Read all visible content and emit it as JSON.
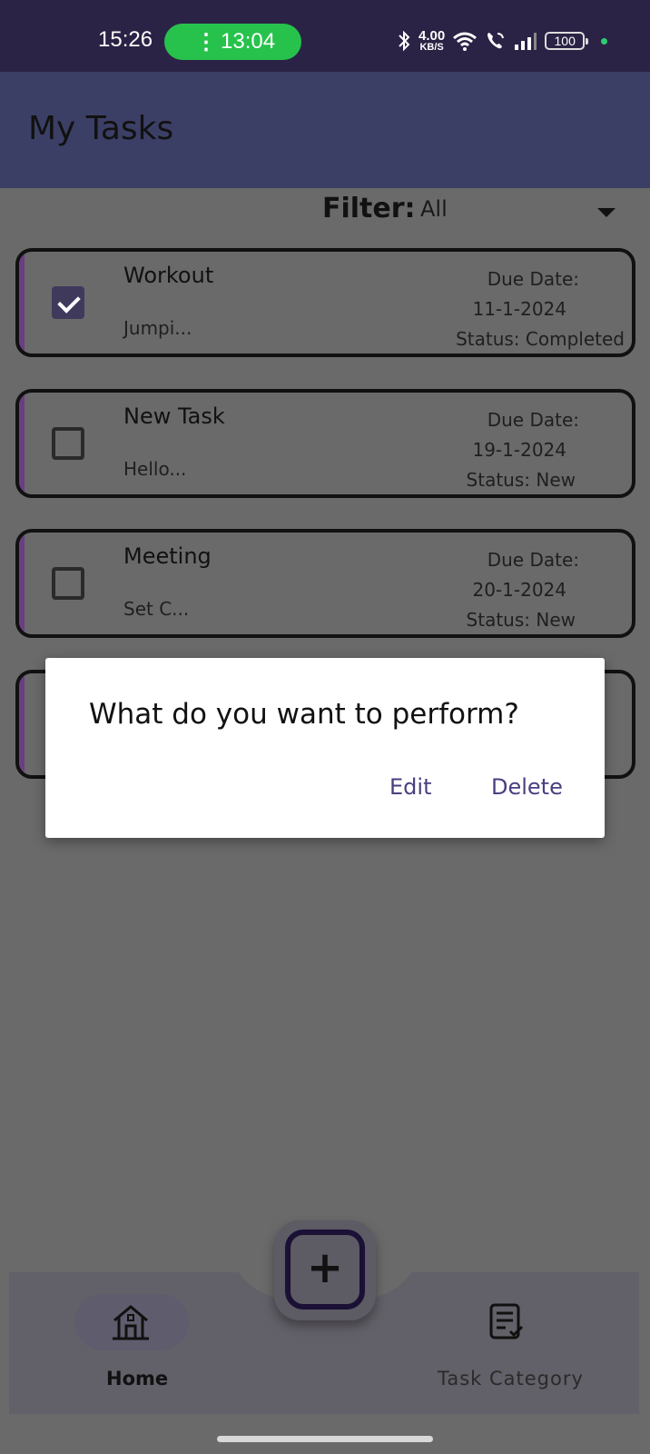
{
  "status_bar": {
    "time": "15:26",
    "timer": "13:04",
    "net_speed": "4.00",
    "net_unit": "KB/S",
    "battery": "100"
  },
  "appbar": {
    "title": "My Tasks"
  },
  "filter": {
    "label": "Filter:",
    "value": "All"
  },
  "tasks": [
    {
      "title": "Workout",
      "desc": "Jumpi...",
      "due_label": "Due Date:",
      "due": "11-1-2024",
      "status": "Status: Completed",
      "checked": true
    },
    {
      "title": "New Task",
      "desc": "Hello...",
      "due_label": "Due Date:",
      "due": "19-1-2024",
      "status": "Status: New",
      "checked": false
    },
    {
      "title": "Meeting",
      "desc": "Set C...",
      "due_label": "Due Date:",
      "due": "20-1-2024",
      "status": "Status: New",
      "checked": false
    }
  ],
  "dialog": {
    "question": "What do you want to perform?",
    "edit": "Edit",
    "delete": "Delete"
  },
  "bottom_nav": {
    "home": "Home",
    "category": "Task Category"
  },
  "icons": {
    "add": "plus-square-icon",
    "home": "home-icon",
    "category": "clipboard-list-icon"
  },
  "colors": {
    "appbar": "#3c3f65",
    "accent": "#6b3d82",
    "dialog_button": "#4a3f80",
    "timer_pill": "#27c24c"
  }
}
